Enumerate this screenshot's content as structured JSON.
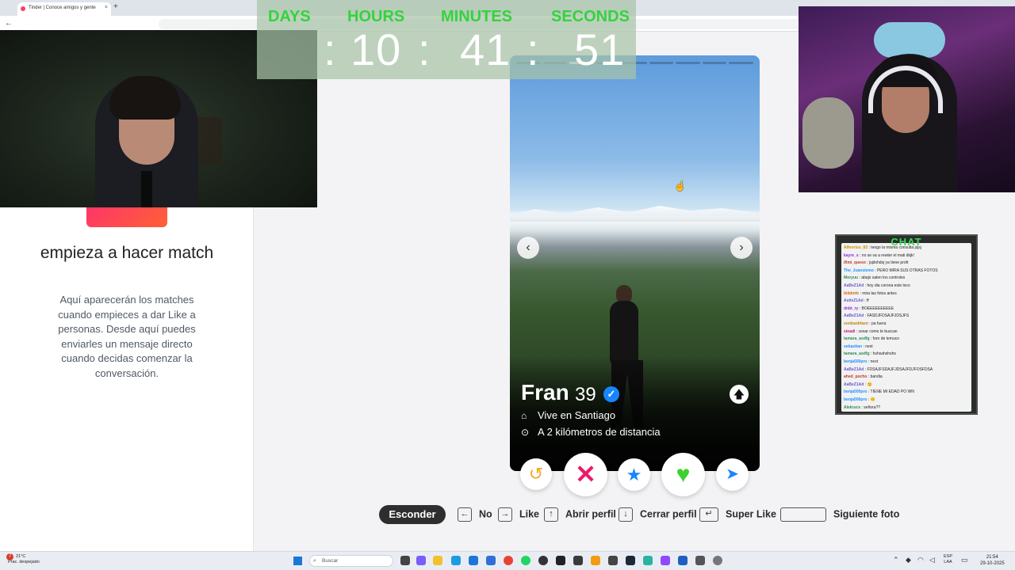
{
  "browser": {
    "tab_title": "Tinder | Conoce amigos y gente",
    "tab_close": "×",
    "new_tab": "+",
    "back": "←"
  },
  "countdown": {
    "labels": {
      "days": "DAYS",
      "hours": "HOURS",
      "minutes": "MINUTES",
      "seconds": "SECONDS"
    },
    "values": {
      "hours": "10",
      "minutes": "41",
      "seconds": "51"
    },
    "separator": ":",
    "label_color": "#36d23e"
  },
  "sidebar": {
    "empty_title": "empieza a hacer match",
    "empty_description": "Aquí aparecerán los matches cuando empieces a dar Like a personas. Desde aquí puedes enviarles un mensaje directo cuando decidas comenzar la conversación."
  },
  "profile": {
    "name": "Fran",
    "age": "39",
    "verified_icon": "✓",
    "location": "Vive en Santiago",
    "distance": "A 2 kilómetros de distancia",
    "photo_count": 9,
    "current_photo": 3,
    "prev_icon": "‹",
    "next_icon": "›",
    "info_icon": "🡅",
    "home_icon": "⌂",
    "pin_icon": "⊙"
  },
  "actions": {
    "rewind": "↺",
    "nope": "✕",
    "super_like": "★",
    "like": "♥",
    "boost": "➤"
  },
  "shortcuts": {
    "hide_label": "Esconder",
    "items": [
      {
        "key": "←",
        "label": "No"
      },
      {
        "key": "→",
        "label": "Like"
      },
      {
        "key": "↑",
        "label": "Abrir perfil"
      },
      {
        "key": "↓",
        "label": "Cerrar perfil"
      },
      {
        "key": "↵",
        "label": "Super Like"
      },
      {
        "key": "",
        "label": "Siguiente foto"
      }
    ]
  },
  "chat": {
    "title": "CHAT",
    "messages": [
      {
        "user": "Alfenriso_83",
        "text": ": tengo la misma consulta jsjsj",
        "color": "#d98c00"
      },
      {
        "user": "kayre_s",
        "text": ": no se va a rewter el mati dkjk!",
        "color": "#8a2be2"
      },
      {
        "user": "ifimi_queso",
        "text": ": jsjdshdsj ya tiene profr",
        "color": "#c0392b"
      },
      {
        "user": "The_Juansiemo",
        "text": ": PERO MIRA SUS OTRAS FOTOS",
        "color": "#1e90ff"
      },
      {
        "user": "Moryuu",
        "text": ": abajo salen los controles",
        "color": "#2e8b57"
      },
      {
        "user": "AaBeZ1Ad",
        "text": ": hoy dia corona este loco",
        "color": "#6a5acd"
      },
      {
        "user": "ibiidmfe",
        "text": ": mira las fotos antes",
        "color": "#d2691e"
      },
      {
        "user": "AstleZ1Ad",
        "text": ": ff",
        "color": "#6a5acd"
      },
      {
        "user": "dnbt_ry",
        "text": ": BOEEEEEEEEEE",
        "color": "#8a2be2"
      },
      {
        "user": "AaBeZ1Ad",
        "text": ": FASDJFDSAJFJDSJFS",
        "color": "#6a5acd"
      },
      {
        "user": "sonbaokfasn",
        "text": ": pa fuera",
        "color": "#b8860b"
      },
      {
        "user": "sinadi",
        "text": ": cesar como te buscan",
        "color": "#c71585"
      },
      {
        "user": "tamara_asdfg",
        "text": ": foro de temuco",
        "color": "#2e8b57"
      },
      {
        "user": "sebastian",
        "text": ": next",
        "color": "#1e90ff"
      },
      {
        "user": "tamara_asdfg",
        "text": ": hshsahshshs",
        "color": "#2e8b57"
      },
      {
        "user": "benja500pro",
        "text": ": next",
        "color": "#1e90ff"
      },
      {
        "user": "AaBeZ1Ad",
        "text": ": FDSAJFSDAJFJDSAJFDJFOSFDSA",
        "color": "#6a5acd"
      },
      {
        "user": "ahed_pocho",
        "text": ": bandia",
        "color": "#c0392b"
      },
      {
        "user": "AaBeZ1Ad",
        "text": ": 😊",
        "color": "#6a5acd"
      },
      {
        "user": "benja500pro",
        "text": ": TIENE MI EDAD PO WN",
        "color": "#1e90ff"
      },
      {
        "user": "benja500pro",
        "text": ": 🙃",
        "color": "#1e90ff"
      },
      {
        "user": "Alekruce",
        "text": ": señora??",
        "color": "#2e8b57"
      }
    ]
  },
  "taskbar": {
    "weather_badge": "7",
    "temp": "21°C",
    "weather": "Prac. despejado",
    "search_placeholder": "Buscar",
    "lang": "ESP",
    "lang_sub": "LAA",
    "time": "21:54",
    "date": "29-10-2025"
  }
}
